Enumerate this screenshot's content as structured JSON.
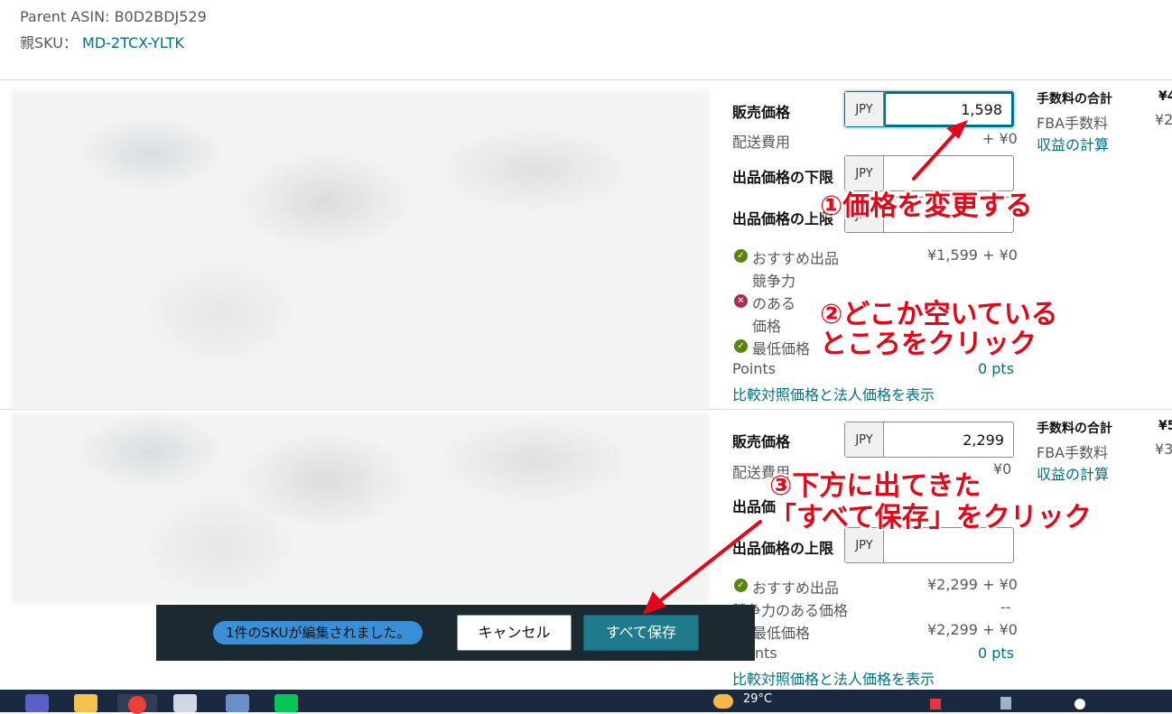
{
  "header": {
    "parent_asin_label": "Parent ASIN:",
    "parent_asin": "B0D2BDJ529",
    "parent_sku_label": "親SKU：",
    "parent_sku": "MD-2TCX-YLTK"
  },
  "rows": [
    {
      "price_label": "販売価格",
      "currency": "JPY",
      "price": "1,598",
      "shipping_label": "配送費用",
      "shipping": "+ ¥0",
      "min_label": "出品価格の下限",
      "max_label": "出品価格の上限",
      "featured_label": "おすすめ出品",
      "featured_value": "¥1,599 + ¥0",
      "competitive_label_1": "競争力",
      "competitive_label_2": "のある",
      "competitive_label_3": "価格",
      "lowest_label": "最低価格",
      "points_label": "Points",
      "points_value": "0 pts",
      "compare_link": "比較対照価格と法人価格を表示",
      "fee_total_label": "手数料の合計",
      "fee_total_value": "¥4",
      "fba_label": "FBA手数料",
      "fba_value": "¥2",
      "profit_link": "収益の計算"
    },
    {
      "price_label": "販売価格",
      "currency": "JPY",
      "price": "2,299",
      "shipping_label": "配送費用",
      "shipping": "¥0",
      "min_label": "出品価",
      "max_label": "出品価格の上限",
      "featured_label": "おすすめ出品",
      "featured_value": "¥2,299 + ¥0",
      "competitive_label": "競争力のある価格",
      "competitive_value": "--",
      "lowest_label": "最低価格",
      "lowest_value": "¥2,299 + ¥0",
      "points_label": "nts",
      "points_value": "0 pts",
      "compare_link": "比較対照価格と法人価格を表示",
      "fee_total_label": "手数料の合計",
      "fee_total_value": "¥5",
      "fba_label": "FBA手数料",
      "fba_value": "¥3",
      "profit_link": "収益の計算"
    }
  ],
  "save_bar": {
    "status": "1件のSKUが編集されました。",
    "cancel": "キャンセル",
    "save_all": "すべて保存"
  },
  "annotations": {
    "step1": "①価格を変更する",
    "step2_line1": "②どこか空いている",
    "step2_line2": "ところをクリック",
    "step3_line1": "③下方に出てきた",
    "step3_line2": "「すべて保存」をクリック"
  },
  "taskbar": {
    "temperature": "29°C"
  },
  "colors": {
    "link": "#007185",
    "annotation": "#e3071a",
    "save_button": "#1f7a8c",
    "taskbar": "#1a2940"
  }
}
